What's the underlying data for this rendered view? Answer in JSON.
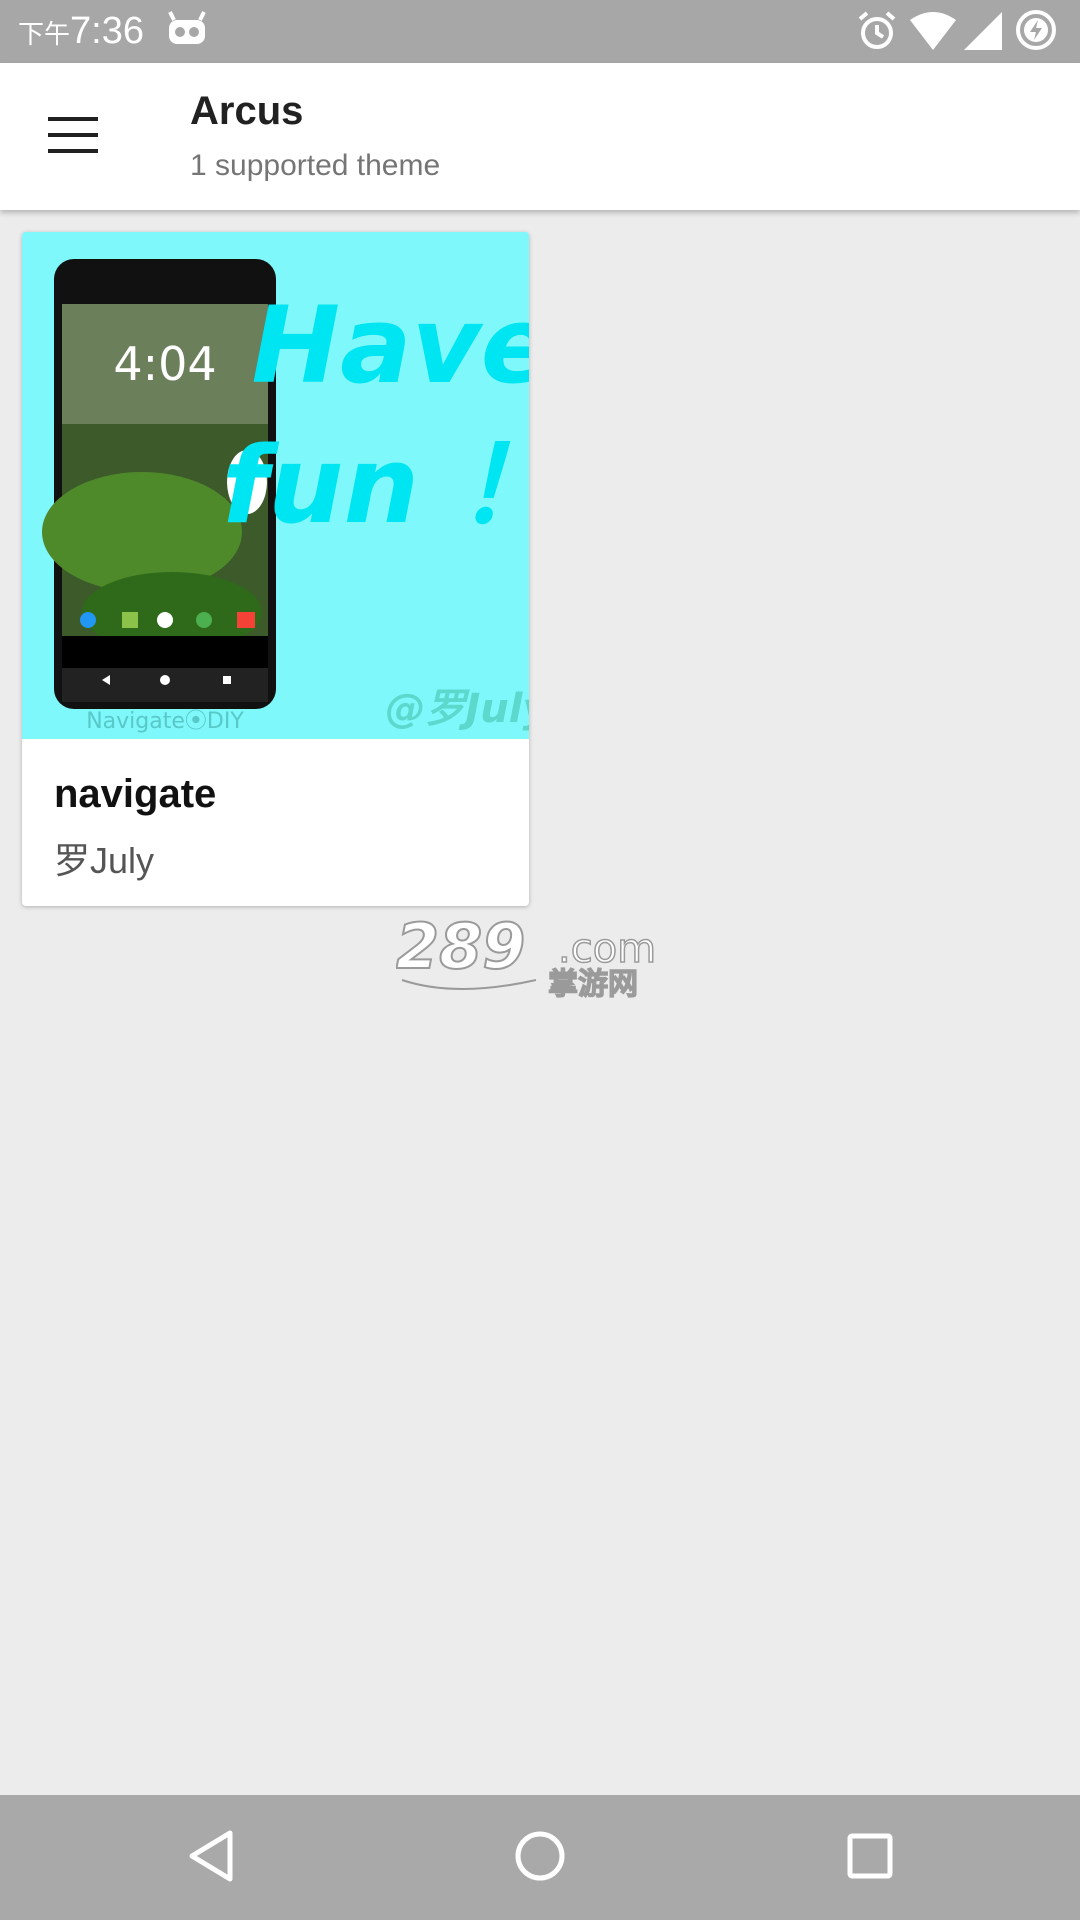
{
  "status_bar": {
    "ampm": "下午",
    "time": "7:36",
    "icons": [
      "android-bot-icon",
      "alarm-icon",
      "wifi-icon",
      "signal-icon",
      "battery-charging-icon"
    ]
  },
  "app_bar": {
    "title": "Arcus",
    "subtitle": "1 supported theme"
  },
  "theme_card": {
    "name": "navigate",
    "author": "罗July",
    "preview": {
      "background": "#7ff8fb",
      "text_line1": "Have",
      "text_line2": "fun ！",
      "signature": "@罗July",
      "caption": "Navigate⦿DIY",
      "phone_clock": "4:04"
    }
  },
  "watermark": {
    "main": "289",
    "suffix": ".com",
    "sub": "掌游网"
  },
  "nav_bar": {
    "icons": [
      "back-icon",
      "home-icon",
      "recents-icon"
    ]
  }
}
